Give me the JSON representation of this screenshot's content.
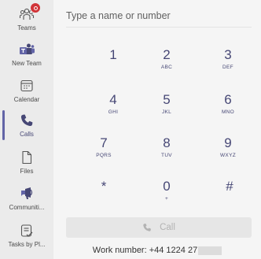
{
  "rail": {
    "items": [
      {
        "label": "Teams",
        "icon": "teams-icon"
      },
      {
        "label": "New Team",
        "icon": "new-team-icon"
      },
      {
        "label": "Calendar",
        "icon": "calendar-icon"
      },
      {
        "label": "Calls",
        "icon": "calls-icon",
        "active": true
      },
      {
        "label": "Files",
        "icon": "files-icon"
      },
      {
        "label": "Communiti...",
        "icon": "communities-icon"
      },
      {
        "label": "Tasks by Pl...",
        "icon": "tasks-icon"
      }
    ]
  },
  "dialer": {
    "search_placeholder": "Type a name or number",
    "keys": [
      {
        "digit": "1",
        "letters": ""
      },
      {
        "digit": "2",
        "letters": "ABC"
      },
      {
        "digit": "3",
        "letters": "DEF"
      },
      {
        "digit": "4",
        "letters": "GHI"
      },
      {
        "digit": "5",
        "letters": "JKL"
      },
      {
        "digit": "6",
        "letters": "MNO"
      },
      {
        "digit": "7",
        "letters": "PQRS"
      },
      {
        "digit": "8",
        "letters": "TUV"
      },
      {
        "digit": "9",
        "letters": "WXYZ"
      },
      {
        "digit": "*",
        "letters": ""
      },
      {
        "digit": "0",
        "letters": "+"
      },
      {
        "digit": "#",
        "letters": ""
      }
    ],
    "call_label": "Call",
    "work_number": "Work number: +44 1224 27"
  },
  "colors": {
    "accent": "#6264a7",
    "key_text": "#464775",
    "badge": "#d13438"
  }
}
